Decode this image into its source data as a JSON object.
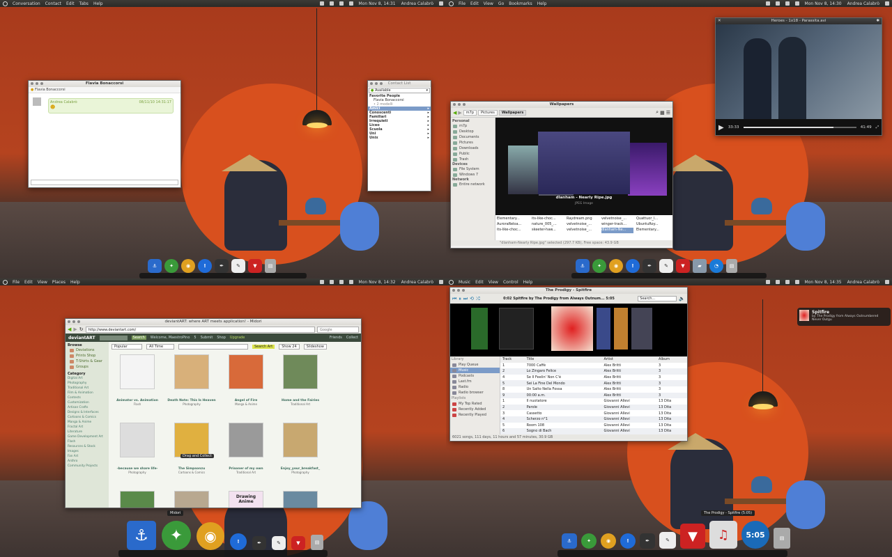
{
  "q1": {
    "menubar": {
      "items": [
        "Conversation",
        "Contact",
        "Edit",
        "Tabs",
        "Help"
      ],
      "clock": "Mon Nov 8, 14:31",
      "user": "Andrea Calabrò"
    },
    "chat": {
      "title": "Flavia Bonaccorsi",
      "contact_line": "Flavia Bonaccorsi",
      "sender": "Andrea Calabrò",
      "timestamp": "08/11/10 14:31:17"
    },
    "contacts": {
      "title": "Contact List",
      "status": "Available",
      "favorites_header": "Favorite People",
      "favorite_name": "Flavia Bonaccorsi",
      "favorite_sub": "• 2 modelli",
      "groups": [
        "Amici",
        "Conoscenti",
        "Familiari",
        "Irrequieti",
        "Liceo",
        "Scuola",
        "Uni",
        "Unix"
      ]
    }
  },
  "q2": {
    "menubar": {
      "items": [
        "File",
        "Edit",
        "View",
        "Go",
        "Bookmarks",
        "Help"
      ],
      "clock": "Mon Nov 8, 14:30",
      "user": "Andrea Calabrò"
    },
    "video": {
      "title": "Heroes - 1x18 - Parassita.avi",
      "elapsed": "33:33",
      "remaining": "41:49",
      "progress": 0.8
    },
    "files": {
      "title": "Wallpapers",
      "crumbs": [
        "m7p",
        "Pictures",
        "Wallpapers"
      ],
      "personal_header": "Personal",
      "personal": [
        "m7p",
        "Desktop",
        "Documents",
        "Pictures",
        "Downloads",
        "Public",
        "Trash"
      ],
      "devices_header": "Devices",
      "devices": [
        "File System",
        "Windows 7"
      ],
      "network_header": "Network",
      "network": [
        "Entire network"
      ],
      "preview_name": "dlanham - Nearly Ripe.jpg",
      "preview_type": "JPEG Image",
      "list": [
        [
          "Elementary...",
          "its-like-choc...",
          "Raydream.png",
          "velvetnoise_...",
          "Quattuor_l..."
        ],
        [
          "AuroraReloa...",
          "nature_005_...",
          "velvetnoise_...",
          "winger-track...",
          "UbuntuRoy..."
        ],
        [
          "its-like-choc...",
          "skeeter-haw...",
          "velvetnoise_...",
          "dlanham-Ne...",
          "Elementary..."
        ]
      ],
      "status": "\"dlanham-Nearly Ripe.jpg\" selected (297.7 KB), Free space: 43.9 GB"
    }
  },
  "q3": {
    "menubar": {
      "items": [
        "File",
        "Edit",
        "View",
        "Places",
        "Help"
      ],
      "clock": "Mon Nov 8, 14:32",
      "user": "Andrea Calabrò"
    },
    "browser": {
      "title": "deviantART: where ART meets application! - Midori",
      "url": "http://www.deviantart.com/",
      "search_placeholder": "Google",
      "logo": "deviantART",
      "search_btn": "Search",
      "welcome": "Welcome, MaestroPino",
      "count": "5",
      "nav": [
        "Submit",
        "Shop",
        "Upgrade"
      ],
      "right": [
        "Friends",
        "Collect"
      ],
      "browse_header": "Browse",
      "browse": [
        "Deviations",
        "Prints Shop",
        "T-Shirts & Gear",
        "Groups"
      ],
      "category_header": "Category",
      "categories": [
        "Digital Art",
        "Photography",
        "Traditional Art",
        "Film & Animation",
        "Contests",
        "Customization",
        "Artisan Crafts",
        "Designs & Interfaces",
        "Cartoons & Comics",
        "Manga & Anime",
        "Fractal Art",
        "Literature",
        "Game Development Art",
        "Flash",
        "Resources & Stock Images",
        "Fan Art",
        "Anthro",
        "Community Projects"
      ],
      "filters": [
        "Popular",
        "All Time",
        "Show 24",
        "Slideshow"
      ],
      "search_art": "Search Art",
      "items": [
        {
          "title": "Animator vs. Animation",
          "cat": "Flash",
          "color": "#f4f4f4"
        },
        {
          "title": "Death Note: This Is Heaven",
          "cat": "Photography",
          "color": "#d8b07a"
        },
        {
          "title": "Angel of Fire",
          "cat": "Manga & Anime",
          "color": "#d86a3a"
        },
        {
          "title": "Home and the Fairies",
          "cat": "Traditional Art",
          "color": "#6f8a5a"
        },
        {
          "title": "-because we share life-",
          "cat": "Photography",
          "color": "#ddd"
        },
        {
          "title": "The Simpsonzu",
          "cat": "Cartoons & Comics",
          "color": "#e0b040"
        },
        {
          "title": "Prisoner of my own",
          "cat": "Traditional Art",
          "color": "#9a9a9a"
        },
        {
          "title": "Enjoy_your_breakfast_",
          "cat": "Photography",
          "color": "#c8a870"
        }
      ],
      "row3_color": [
        "#5a8a4a",
        "#b8a890",
        "#f3e2f0",
        "#6a8aa0"
      ],
      "row3_text": "Drawing Anime",
      "tooltip": "Drag and Collect",
      "dock_label": "Midori"
    }
  },
  "q4": {
    "menubar": {
      "items": [
        "Music",
        "Edit",
        "View",
        "Control",
        "Help"
      ],
      "clock": "Mon Nov 8, 14:35",
      "user": "Andrea Calabrò"
    },
    "player": {
      "title": "The Prodigy - Spitfire",
      "now": "0:02 Spitfire by The Prodigy from Always Outnum... 5:05",
      "search_placeholder": "Search...",
      "library_header": "Library",
      "library": [
        "Play Queue",
        "Music",
        "Podcasts",
        "Last.fm",
        "Radio",
        "Radio browser"
      ],
      "playlists_header": "Playlists",
      "playlists": [
        "My Top Rated",
        "Recently Added",
        "Recently Played"
      ],
      "columns": [
        "Track",
        "Title",
        "Artist",
        "Album"
      ],
      "rows": [
        [
          "1",
          "7000 Caffè",
          "Alex Britti",
          "3"
        ],
        [
          "2",
          "Lo Zingaro Felice",
          "Alex Britti",
          "3"
        ],
        [
          "4",
          "Se Il Feelin' Non C'è",
          "Alex Britti",
          "3"
        ],
        [
          "5",
          "Sei La Fine Del Mondo",
          "Alex Britti",
          "3"
        ],
        [
          "8",
          "Un Salto Nella Fossa",
          "Alex Britti",
          "3"
        ],
        [
          "9",
          "00:00 a.m.",
          "Alex Britti",
          "3"
        ],
        [
          "1",
          "Il nuotatore",
          "Giovanni Allevi",
          "13 Dita"
        ],
        [
          "2",
          "Parole",
          "Giovanni Allevi",
          "13 Dita"
        ],
        [
          "3",
          "Cassetto",
          "Giovanni Allevi",
          "13 Dita"
        ],
        [
          "4",
          "Scherzo n°1",
          "Giovanni Allevi",
          "13 Dita"
        ],
        [
          "5",
          "Room 108",
          "Giovanni Allevi",
          "13 Dita"
        ],
        [
          "6",
          "Sogno di Bach",
          "Giovanni Allevi",
          "13 Dita"
        ]
      ],
      "status": "6021 songs, 111 days, 11 hours and 57 minutes, 30.9 GB"
    },
    "notification": {
      "title": "Spitfire",
      "body": "by The Prodigy from Always Outnumbered Never Outgu"
    },
    "dock_label": "The Prodigy - Spitfire (5:05)",
    "dock_time": "5:05"
  }
}
